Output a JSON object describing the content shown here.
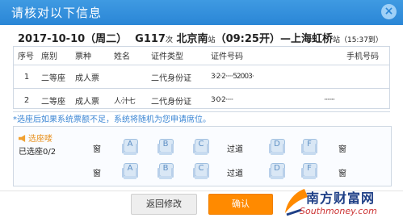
{
  "dialog": {
    "title": "请核对以下信息",
    "close_glyph": "×"
  },
  "trip": {
    "date": "2017-10-10",
    "weekday": "（周二）",
    "train": "G117",
    "train_suffix": "次",
    "from": "北京南",
    "from_suffix": "站",
    "depart": "（09:25开）",
    "dash": "—",
    "to": "上海虹桥",
    "to_suffix": "站",
    "duration": "（15:37到）"
  },
  "table": {
    "headers": [
      "序号",
      "席别",
      "票种",
      "姓名",
      "证件类型",
      "证件号码",
      "手机号码"
    ],
    "rows": [
      {
        "no": "1",
        "seat": "二等座",
        "ticket": "成人票",
        "name": "",
        "idtype": "二代身份证",
        "idno": "3·2·2·····52003·",
        "phone": ""
      },
      {
        "no": "2",
        "seat": "二等座",
        "ticket": "成人票",
        "name": "人·汁七",
        "idtype": "二代身份证",
        "idno": "3·0·2·····",
        "phone": "·······"
      }
    ]
  },
  "note": "*选座后如果系统票额不足，系统将随机为您申请席位。",
  "seat_select": {
    "title": "选座喽",
    "count": "已选座0/2",
    "window": "窗",
    "aisle": "过道",
    "seats": [
      "A",
      "B",
      "C",
      "D",
      "F"
    ]
  },
  "buttons": {
    "back": "返回修改",
    "confirm": "确认"
  },
  "watermark": {
    "line1": "南方财富网",
    "line2": "Southmoney.com"
  },
  "colors": {
    "titlebar": "#2a86d6",
    "confirm": "#ff8a00",
    "note": "#3b86d4",
    "select_title": "#e8911f"
  }
}
